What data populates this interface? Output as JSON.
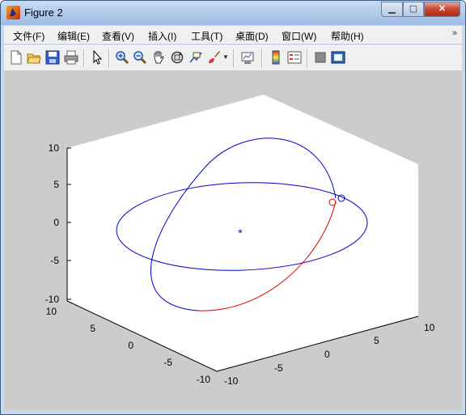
{
  "window": {
    "title": "Figure 2"
  },
  "menu": {
    "items": [
      "文件(F)",
      "编辑(E)",
      "查看(V)",
      "插入(I)",
      "工具(T)",
      "桌面(D)",
      "窗口(W)",
      "帮助(H)"
    ],
    "overflow_glyph": "»"
  },
  "toolbar": {
    "buttons": [
      "new-figure-icon",
      "open-folder-icon",
      "save-icon",
      "print-icon",
      "pointer-icon",
      "zoom-in-icon",
      "zoom-out-icon",
      "pan-hand-icon",
      "rotate-3d-icon",
      "data-cursor-icon",
      "brush-icon",
      "link-plot-icon",
      "colorbar-icon",
      "legend-icon",
      "hide-plot-tools-icon",
      "show-plot-tools-icon"
    ]
  },
  "axes": {
    "z_ticks": [
      "10",
      "5",
      "0",
      "-5",
      "-10"
    ],
    "y_ticks": [
      "10",
      "5",
      "0",
      "-5",
      "-10"
    ],
    "x_ticks": [
      "-10",
      "-5",
      "0",
      "5",
      "10"
    ],
    "center_marker": "*",
    "circle_markers": 2
  },
  "colors": {
    "orbit_blue": "#0000cc",
    "orbit_red": "#dd0000",
    "figure_bg": "#cccccc",
    "window_frame": "#a9c2e4"
  }
}
